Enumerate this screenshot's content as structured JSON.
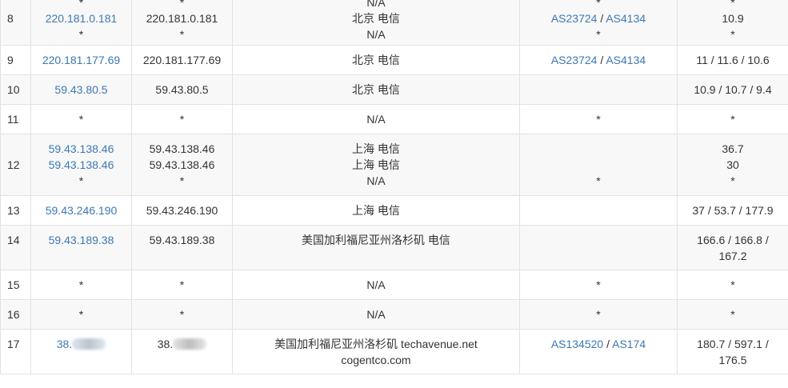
{
  "rows": [
    {
      "hop": "8",
      "ip": [
        "*",
        "220.181.0.181",
        "*"
      ],
      "host": [
        "*",
        "220.181.0.181",
        "*"
      ],
      "geo": [
        "N/A",
        "北京 电信",
        "N/A"
      ],
      "as": [
        "*",
        "AS23724 / AS4134",
        "*"
      ],
      "as_links": [
        [],
        [
          "AS23724",
          "AS4134"
        ],
        []
      ],
      "time": [
        "*",
        "10.9",
        "*"
      ]
    },
    {
      "hop": "9",
      "ip": [
        "220.181.177.69"
      ],
      "host": [
        "220.181.177.69"
      ],
      "geo": [
        "北京 电信"
      ],
      "as": [
        "AS23724 / AS4134"
      ],
      "as_links": [
        [
          "AS23724",
          "AS4134"
        ]
      ],
      "time": [
        "11 / 11.6 / 10.6"
      ]
    },
    {
      "hop": "10",
      "ip": [
        "59.43.80.5"
      ],
      "host": [
        "59.43.80.5"
      ],
      "geo": [
        "北京 电信"
      ],
      "as": [
        ""
      ],
      "as_links": [
        []
      ],
      "time": [
        "10.9 / 10.7 / 9.4"
      ]
    },
    {
      "hop": "11",
      "ip": [
        "*"
      ],
      "host": [
        "*"
      ],
      "geo": [
        "N/A"
      ],
      "as": [
        "*"
      ],
      "as_links": [
        []
      ],
      "time": [
        "*"
      ]
    },
    {
      "hop": "12",
      "ip": [
        "59.43.138.46",
        "59.43.138.46",
        "*"
      ],
      "host": [
        "59.43.138.46",
        "59.43.138.46",
        "*"
      ],
      "geo": [
        "上海 电信",
        "上海 电信",
        "N/A"
      ],
      "as": [
        "",
        "",
        "*"
      ],
      "as_links": [
        [],
        [],
        []
      ],
      "time": [
        "36.7",
        "30",
        "*"
      ]
    },
    {
      "hop": "13",
      "ip": [
        "59.43.246.190"
      ],
      "host": [
        "59.43.246.190"
      ],
      "geo": [
        "上海 电信"
      ],
      "as": [
        ""
      ],
      "as_links": [
        []
      ],
      "time": [
        "37 / 53.7 / 177.9"
      ]
    },
    {
      "hop": "14",
      "ip": [
        "59.43.189.38"
      ],
      "host": [
        "59.43.189.38"
      ],
      "geo": [
        "美国加利福尼亚州洛杉矶 电信"
      ],
      "as": [
        ""
      ],
      "as_links": [
        []
      ],
      "time": [
        "166.6 / 166.8 /",
        "167.2"
      ],
      "top_aligned": true
    },
    {
      "hop": "15",
      "ip": [
        "*"
      ],
      "host": [
        "*"
      ],
      "geo": [
        "N/A"
      ],
      "as": [
        "*"
      ],
      "as_links": [
        []
      ],
      "time": [
        "*"
      ]
    },
    {
      "hop": "16",
      "ip": [
        "*"
      ],
      "host": [
        "*"
      ],
      "geo": [
        "N/A"
      ],
      "as": [
        "*"
      ],
      "as_links": [
        []
      ],
      "time": [
        "*"
      ]
    },
    {
      "hop": "17",
      "ip": [
        "38."
      ],
      "host": [
        "38."
      ],
      "ip_redacted": true,
      "geo": [
        "美国加利福尼亚州洛杉矶 techavenue.net",
        "cogentco.com"
      ],
      "as": [
        "AS134520 / AS174"
      ],
      "as_links": [
        [
          "AS134520",
          "AS174"
        ]
      ],
      "time": [
        "180.7 / 597.1 /",
        "176.5"
      ],
      "top_aligned": true
    }
  ],
  "colors": {
    "link": "#3c78b4",
    "text": "#333333",
    "border": "#e2e2e2",
    "row_alt": "#f8f8f8"
  }
}
